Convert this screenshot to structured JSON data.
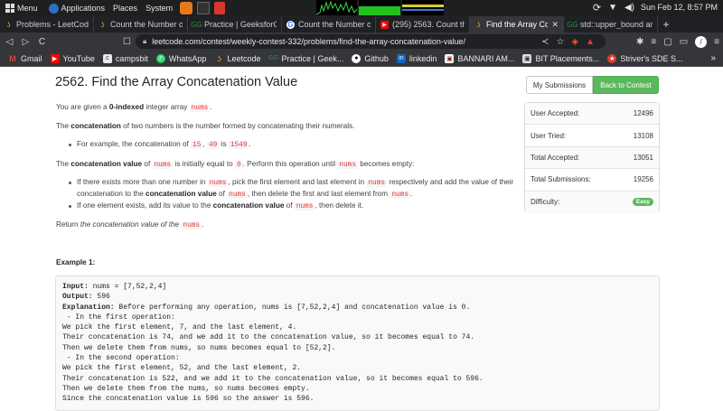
{
  "os": {
    "menu_label": "Menu",
    "applications_label": "Applications",
    "places_label": "Places",
    "system_label": "System",
    "clock": "Sun Feb 12,  8:57 PM"
  },
  "tabs": [
    {
      "title": "Problems - LeetCode",
      "icon": "leetcode-icon",
      "color": "#f0a030"
    },
    {
      "title": "Count the Number of",
      "icon": "leetcode-icon",
      "color": "#f0a030"
    },
    {
      "title": "Practice | GeeksforG",
      "icon": "geeksforgeeks-icon",
      "color": "#2f8d46"
    },
    {
      "title": "Count the Number of",
      "icon": "google-icon",
      "color": "#4285f4"
    },
    {
      "title": "(295) 2563. Count the",
      "icon": "youtube-icon",
      "color": "#ff0000"
    },
    {
      "title": "Find the Array Con",
      "icon": "leetcode-icon",
      "color": "#f0a030",
      "active": true
    },
    {
      "title": "std::upper_bound an",
      "icon": "geeksforgeeks-icon",
      "color": "#2f8d46"
    }
  ],
  "address": {
    "url": "leetcode.com/contest/weekly-contest-332/problems/find-the-array-concatenation-value/"
  },
  "bookmarks": [
    {
      "label": "Gmail",
      "icon": "gmail-icon",
      "color": "#d44638"
    },
    {
      "label": "YouTube",
      "icon": "youtube-icon",
      "color": "#ff0000"
    },
    {
      "label": "campsbit",
      "icon": "campsbit-icon",
      "color": "#555555"
    },
    {
      "label": "WhatsApp",
      "icon": "whatsapp-icon",
      "color": "#25d366"
    },
    {
      "label": "Leetcode",
      "icon": "leetcode-icon",
      "color": "#f0a030"
    },
    {
      "label": "Practice | Geek...",
      "icon": "geeksforgeeks-icon",
      "color": "#2f8d46"
    },
    {
      "label": "Github",
      "icon": "github-icon",
      "color": "#ffffff"
    },
    {
      "label": "linkedin",
      "icon": "linkedin-icon",
      "color": "#0a66c2"
    },
    {
      "label": "BANNARI AM...",
      "icon": "bannari-icon",
      "color": "#8b1d1d"
    },
    {
      "label": "BIT Placements...",
      "icon": "bit-icon",
      "color": "#6b6b6b"
    },
    {
      "label": "Striver's SDE S...",
      "icon": "striver-icon",
      "color": "#e23b2e"
    }
  ],
  "problem": {
    "title": "2562. Find the Array Concatenation Value",
    "p1_a": "You are given a ",
    "p1_b": "0-indexed",
    "p1_c": " integer array ",
    "p1_code": "nums",
    "p1_d": ".",
    "p2_a": "The ",
    "p2_b": "concatenation",
    "p2_c": " of two numbers is the number formed by concatenating their numerals.",
    "b1_a": "For example, the concatenation of ",
    "b1_c1": "15",
    "b1_sep": ", ",
    "b1_c2": "49",
    "b1_is": " is ",
    "b1_c3": "1549",
    "b1_end": ".",
    "p3_a": "The ",
    "p3_b": "concatenation value",
    "p3_c": " of ",
    "p3_code": "nums",
    "p3_d": " is initially equal to ",
    "p3_code2": "0",
    "p3_e": ". Perform this operation until ",
    "p3_code3": "nums",
    "p3_f": " becomes empty:",
    "b2_l1a": "If there exists more than one number in ",
    "b2_l1code": "nums",
    "b2_l1b": ", pick the first element and last element in ",
    "b2_l1code2": "nums",
    "b2_l1c": " respectively and add the value of their",
    "b2_l2a": "concatenation to the ",
    "b2_l2b": "concatenation value",
    "b2_l2c": " of ",
    "b2_l2code": "nums",
    "b2_l2d": ", then delete the first and last element from ",
    "b2_l2code2": "nums",
    "b2_l2e": ".",
    "b3_a": "If one element exists, add its value to the ",
    "b3_b": "concatenation value",
    "b3_c": " of ",
    "b3_code": "nums",
    "b3_d": ", then delete it.",
    "p4_a": "Return ",
    "p4_i": "the concatenation value of the ",
    "p4_code": "nums",
    "p4_b": ".",
    "example_label": "Example 1:",
    "ex_input_label": "Input:",
    "ex_input": " nums = [7,52,2,4]",
    "ex_output_label": "Output:",
    "ex_output": " 596",
    "ex_expl_label": "Explanation:",
    "ex_expl": " Before performing any operation, nums is [7,52,2,4] and concatenation value is 0.",
    "ex_lines": [
      " - In the first operation:",
      "We pick the first element, 7, and the last element, 4.",
      "Their concatenation is 74, and we add it to the concatenation value, so it becomes equal to 74.",
      "Then we delete them from nums, so nums becomes equal to [52,2].",
      " - In the second operation:",
      "We pick the first element, 52, and the last element, 2.",
      "Their concatenation is 522, and we add it to the concatenation value, so it becomes equal to 596.",
      "Then we delete them from the nums, so nums becomes empty.",
      "Since the concatenation value is 596 so the answer is 596."
    ]
  },
  "sidebar": {
    "my_submissions": "My Submissions",
    "back_to_contest": "Back to Contest",
    "stats": [
      {
        "label": "User Accepted:",
        "value": "12496"
      },
      {
        "label": "User Tried:",
        "value": "13108"
      },
      {
        "label": "Total Accepted:",
        "value": "13051"
      },
      {
        "label": "Total Submissions:",
        "value": "19256"
      },
      {
        "label": "Difficulty:",
        "value": "Easy"
      }
    ]
  }
}
